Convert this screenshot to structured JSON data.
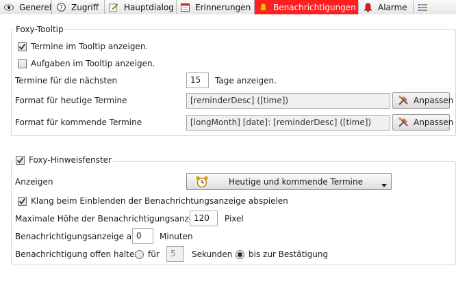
{
  "tabs": [
    {
      "label": "Generelles",
      "icon": "eye-icon"
    },
    {
      "label": "Zugriff",
      "icon": "help-icon"
    },
    {
      "label": "Hauptdialog",
      "icon": "edit-icon"
    },
    {
      "label": "Erinnerungen",
      "icon": "calendar-icon"
    },
    {
      "label": "Benachrichtigungen",
      "icon": "bell-icon",
      "active": true
    },
    {
      "label": "Alarme",
      "icon": "alarm-bell-icon"
    },
    {
      "label": "",
      "icon": "list-icon"
    }
  ],
  "tooltip": {
    "legend": "Foxy-Tooltip",
    "show_appointments": {
      "label": "Termine im Tooltip anzeigen.",
      "checked": true
    },
    "show_tasks": {
      "label": "Aufgaben im Tooltip anzeigen.",
      "checked": false
    },
    "days": {
      "label": "Termine für die nächsten",
      "value": "15",
      "suffix": "Tage anzeigen."
    },
    "format_today": {
      "label": "Format für heutige Termine",
      "value": "[reminderDesc] ([time])",
      "button": "Anpassen"
    },
    "format_upcoming": {
      "label": "Format für kommende Termine",
      "value": "[longMonth] [date]: [reminderDesc] ([time])",
      "button": "Anpassen"
    }
  },
  "notify": {
    "legend": "Foxy-Hinweisfenster",
    "legend_checked": true,
    "show": {
      "label": "Anzeigen",
      "selected": "Heutige und kommende Termine"
    },
    "sound": {
      "label": "Klang beim Einblenden der Benachrichtungsanzeige abspielen",
      "checked": true
    },
    "max_height": {
      "label": "Maximale Höhe der Benachrichtigungsanzeige",
      "value": "120",
      "suffix": "Pixel"
    },
    "interval": {
      "label": "Benachrichtigungsanzeige alle",
      "value": "0",
      "suffix": "Minuten"
    },
    "keep_open": {
      "label": "Benachrichtigung offen halten",
      "option_for": "für",
      "seconds_value": "5",
      "seconds_label": "Sekunden",
      "option_until": "bis zur Bestätigung",
      "selected": "until"
    }
  },
  "colors": {
    "active_tab": "#ff1f1f",
    "accent": "#2a5db0"
  }
}
